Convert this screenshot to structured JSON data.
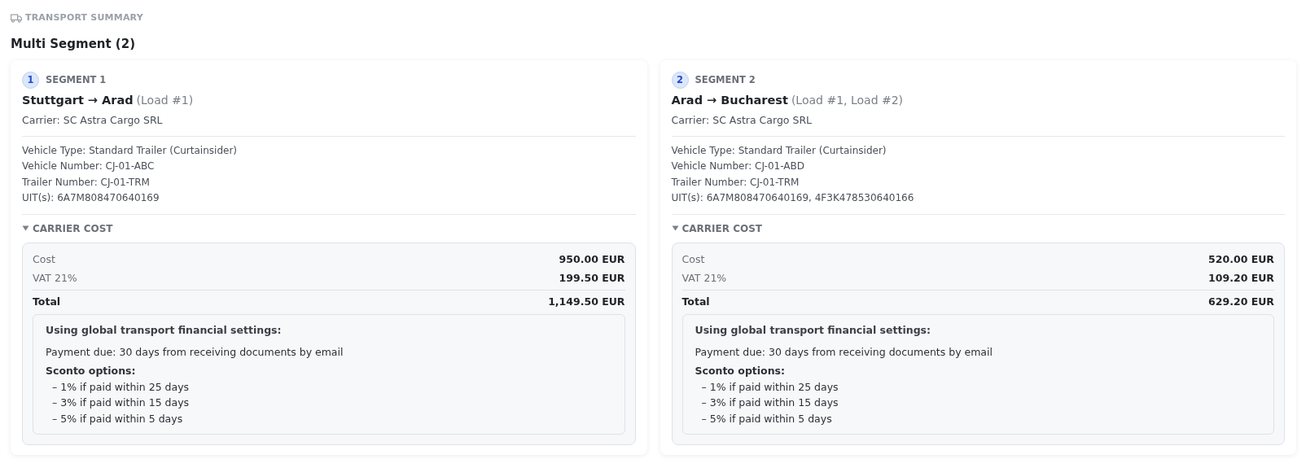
{
  "header": {
    "label": "TRANSPORT SUMMARY"
  },
  "title": "Multi Segment (2)",
  "segments": [
    {
      "number": "1",
      "label": "SEGMENT 1",
      "route": "Stuttgart → Arad",
      "loads": "(Load #1)",
      "carrier": "Carrier: SC Astra Cargo SRL",
      "details": [
        "Vehicle Type: Standard Trailer (Curtainsider)",
        "Vehicle Number: CJ-01-ABC",
        "Trailer Number: CJ-01-TRM",
        "UIT(s): 6A7M808470640169"
      ],
      "cost_section": {
        "label": "CARRIER COST",
        "expanded": true,
        "rows": [
          {
            "label": "Cost",
            "value": "950.00 EUR",
            "kind": "line"
          },
          {
            "label": "VAT 21%",
            "value": "199.50 EUR",
            "kind": "line"
          },
          {
            "label": "Total",
            "value": "1,149.50 EUR",
            "kind": "total"
          }
        ],
        "settings": {
          "title": "Using global transport financial settings:",
          "payment": "Payment due: 30 days from receiving documents by email",
          "sconto_title": "Sconto options:",
          "options": [
            "– 1% if paid within 25 days",
            "– 3% if paid within 15 days",
            "– 5% if paid within 5 days"
          ]
        }
      }
    },
    {
      "number": "2",
      "label": "SEGMENT 2",
      "route": "Arad → Bucharest",
      "loads": "(Load #1, Load #2)",
      "carrier": "Carrier: SC Astra Cargo SRL",
      "details": [
        "Vehicle Type: Standard Trailer (Curtainsider)",
        "Vehicle Number: CJ-01-ABD",
        "Trailer Number: CJ-01-TRM",
        "UIT(s): 6A7M808470640169, 4F3K478530640166"
      ],
      "cost_section": {
        "label": "CARRIER COST",
        "expanded": true,
        "rows": [
          {
            "label": "Cost",
            "value": "520.00 EUR",
            "kind": "line"
          },
          {
            "label": "VAT 21%",
            "value": "109.20 EUR",
            "kind": "line"
          },
          {
            "label": "Total",
            "value": "629.20 EUR",
            "kind": "total"
          }
        ],
        "settings": {
          "title": "Using global transport financial settings:",
          "payment": "Payment due: 30 days from receiving documents by email",
          "sconto_title": "Sconto options:",
          "options": [
            "– 1% if paid within 25 days",
            "– 3% if paid within 15 days",
            "– 5% if paid within 5 days"
          ]
        }
      }
    }
  ]
}
